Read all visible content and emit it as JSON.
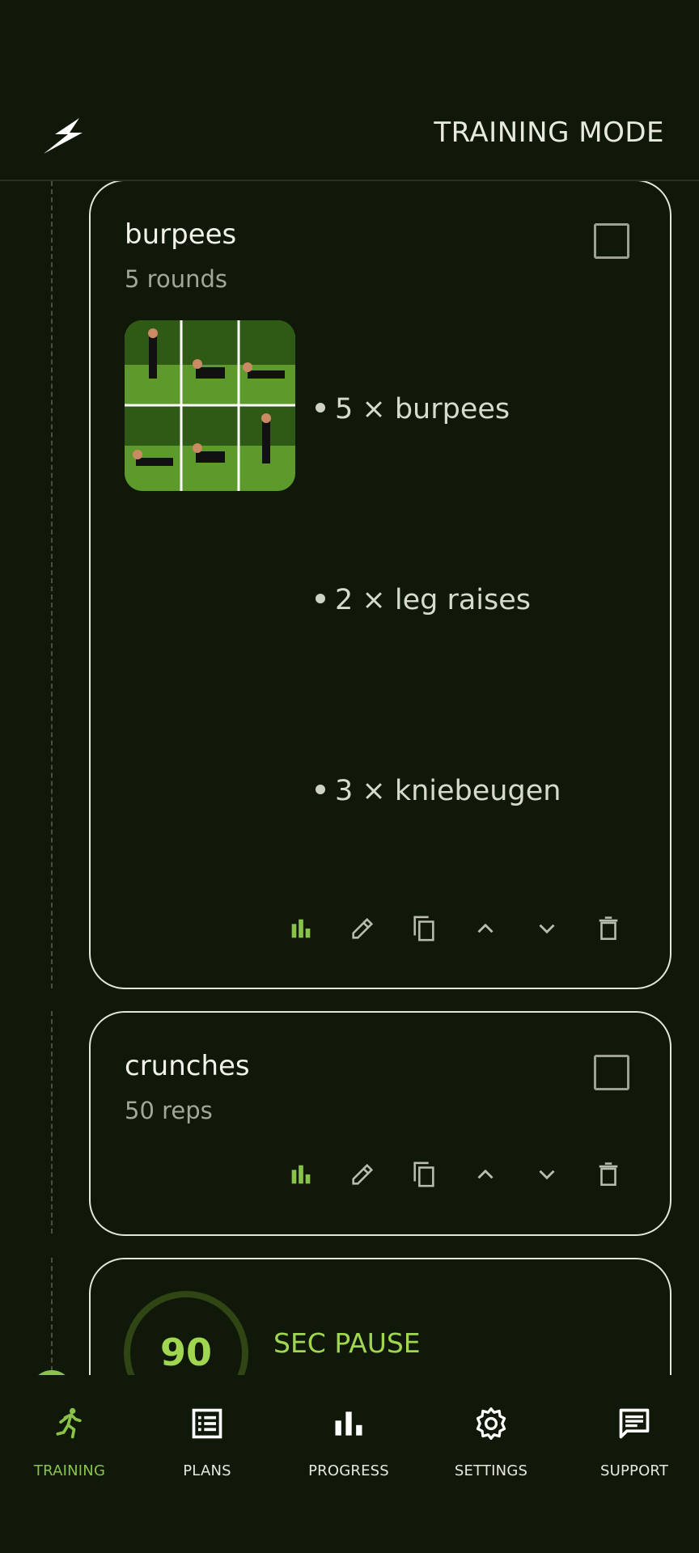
{
  "header": {
    "title": "TRAINING MODE",
    "logo_icon": "lightning-bolt-icon"
  },
  "colors": {
    "background": "#101809",
    "accent": "#8bc34a",
    "card_border": "#e3e7d6"
  },
  "cards": [
    {
      "title": "burpees",
      "subtitle": "5 rounds",
      "checked": false,
      "steps": [
        "5 × burpees",
        "2 × leg raises",
        "3 × kniebeugen"
      ]
    },
    {
      "title": "crunches",
      "subtitle": "50 reps",
      "checked": false
    }
  ],
  "pause": {
    "value": "90",
    "label": "SEC PAUSE"
  },
  "actions": [
    "stats-icon",
    "edit-icon",
    "copy-icon",
    "move-up-icon",
    "move-down-icon",
    "delete-icon"
  ],
  "nav": [
    {
      "label": "TRAINING",
      "icon": "running-icon",
      "active": true
    },
    {
      "label": "PLANS",
      "icon": "list-icon",
      "active": false
    },
    {
      "label": "PROGRESS",
      "icon": "bar-chart-icon",
      "active": false
    },
    {
      "label": "SETTINGS",
      "icon": "gear-icon",
      "active": false
    },
    {
      "label": "SUPPORT",
      "icon": "chat-icon",
      "active": false
    }
  ]
}
